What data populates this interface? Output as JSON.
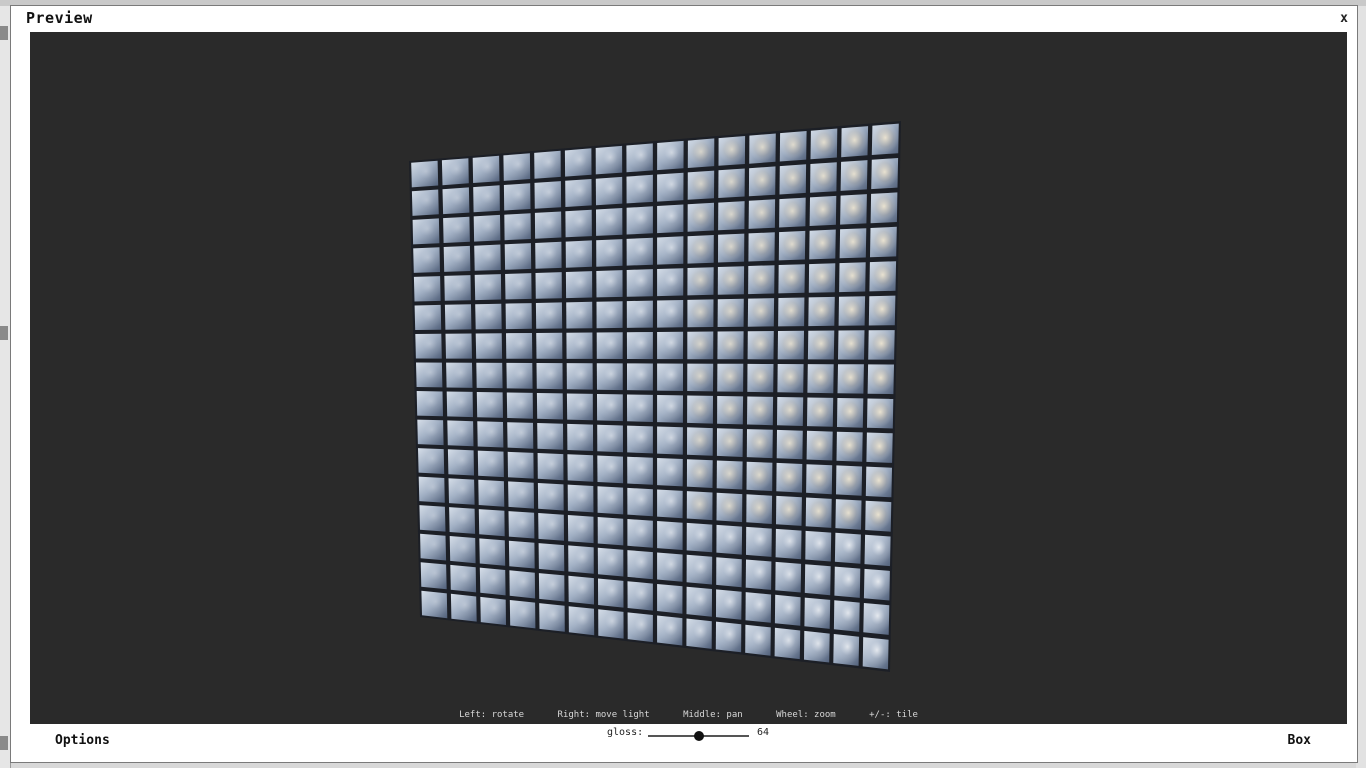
{
  "window": {
    "title": "Preview",
    "close_label": "x"
  },
  "viewport": {
    "texture": "blue-gray metallic square tiles",
    "grid": {
      "columns": 16,
      "rows": 16
    },
    "background_color": "#2a2a2a"
  },
  "hints": {
    "left": "Left: rotate",
    "right": "Right: move light",
    "middle": "Middle: pan",
    "wheel": "Wheel: zoom",
    "tile": "+/-: tile"
  },
  "controls": {
    "options_label": "Options",
    "box_label": "Box",
    "gloss": {
      "label": "gloss:",
      "value": "64",
      "level_fraction": 0.5
    }
  },
  "colors": {
    "modal_bg": "#ffffff",
    "viewport_bg": "#2a2a2a",
    "hint_text": "#d8d8d8",
    "tile_base": "#9eadc2"
  }
}
